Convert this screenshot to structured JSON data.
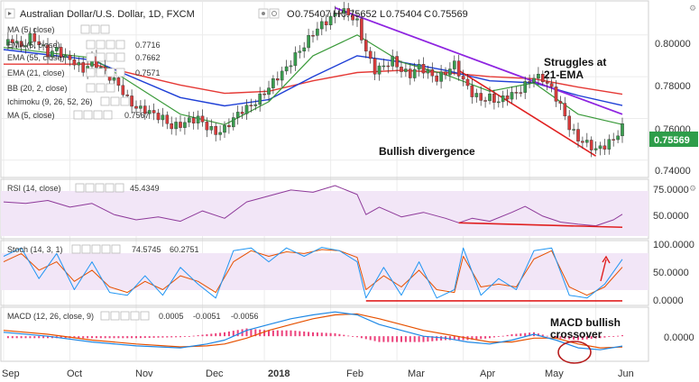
{
  "header": {
    "symbol": "Australian Dollar/U.S. Dollar, 1D, FXCM",
    "o_label": "O",
    "o": "0.75407",
    "h_label": "H",
    "h": "0.75652",
    "l_label": "L",
    "l": "0.75404",
    "c_label": "C",
    "c": "0.75569"
  },
  "indicators": [
    {
      "label": "MA (5, close)",
      "value": "",
      "color": "#222222"
    },
    {
      "label": "EMA (5, close)",
      "value": "0.7716",
      "color": "#e53935"
    },
    {
      "label": "EMA (55, close)",
      "value": "0.7662",
      "color": "#1e3fd6"
    },
    {
      "label": "EMA (21, close)",
      "value": "0.7571",
      "color": "#3a9a3a"
    },
    {
      "label": "BB (20, 2, close)",
      "value": "",
      "color": "#222222"
    },
    {
      "label": "Ichimoku (9, 26, 52, 26)",
      "value": "",
      "color": "#222222"
    },
    {
      "label": "MA (5, close)",
      "value": "0.7567",
      "color": "#1e3fd6"
    }
  ],
  "price_axis": {
    "ticks": [
      "0.80000",
      "0.78000",
      "0.76000",
      "0.74000"
    ],
    "current": "0.75569",
    "current_color": "#2e9d4a"
  },
  "time_axis": {
    "labels": [
      "Sep",
      "Oct",
      "Nov",
      "Dec",
      "2018",
      "Feb",
      "Mar",
      "Apr",
      "May",
      "Jun"
    ]
  },
  "rsi": {
    "label": "RSI (14, close)",
    "value": "45.4349",
    "value_color": "#8e3a9a",
    "ticks": [
      "75.0000",
      "50.0000"
    ]
  },
  "stoch": {
    "label": "Stoch (14, 3, 1)",
    "k": "74.5745",
    "k_color": "#2196f3",
    "d": "60.2751",
    "d_color": "#e65100",
    "ticks": [
      "100.0000",
      "50.0000",
      "0.0000"
    ]
  },
  "macd": {
    "label": "MACD (12, 26, close, 9)",
    "hist": "0.0005",
    "hist_color": "#e91e63",
    "macd": "-0.0051",
    "macd_color": "#1e88e5",
    "signal": "-0.0056",
    "signal_color": "#e65100",
    "ticks": [
      "0.0000"
    ]
  },
  "annotations": {
    "struggles_line1": "Struggles at",
    "struggles_line2": "21-EMA",
    "divergence": "Bullish divergence",
    "macd_line1": "MACD bullish",
    "macd_line2": "crossover"
  },
  "colors": {
    "candle_up": "#3a9d4f",
    "candle_down": "#d83b3b",
    "trendline": "#8e24e0",
    "support": "#e02020"
  },
  "chart_data": [
    {
      "type": "candlestick",
      "title": "Australian Dollar/U.S. Dollar, 1D, FXCM",
      "ylim": [
        0.733,
        0.815
      ],
      "x": [
        "Sep",
        "Oct",
        "Nov",
        "Dec",
        "2018",
        "Feb",
        "Mar",
        "Apr",
        "May",
        "Jun"
      ],
      "close_path": [
        [
          0,
          0.795
        ],
        [
          2,
          0.798
        ],
        [
          4,
          0.794
        ],
        [
          6,
          0.799
        ],
        [
          8,
          0.796
        ],
        [
          10,
          0.791
        ],
        [
          12,
          0.793
        ],
        [
          14,
          0.789
        ],
        [
          16,
          0.787
        ],
        [
          18,
          0.783
        ],
        [
          20,
          0.788
        ],
        [
          22,
          0.784
        ],
        [
          24,
          0.78
        ],
        [
          26,
          0.776
        ],
        [
          28,
          0.769
        ],
        [
          30,
          0.765
        ],
        [
          32,
          0.764
        ],
        [
          34,
          0.762
        ],
        [
          36,
          0.76
        ],
        [
          38,
          0.756
        ],
        [
          40,
          0.757
        ],
        [
          42,
          0.759
        ],
        [
          44,
          0.76
        ],
        [
          46,
          0.756
        ],
        [
          48,
          0.753
        ],
        [
          50,
          0.755
        ],
        [
          52,
          0.76
        ],
        [
          54,
          0.764
        ],
        [
          56,
          0.766
        ],
        [
          58,
          0.77
        ],
        [
          60,
          0.775
        ],
        [
          62,
          0.78
        ],
        [
          64,
          0.784
        ],
        [
          66,
          0.79
        ],
        [
          68,
          0.795
        ],
        [
          70,
          0.801
        ],
        [
          72,
          0.805
        ],
        [
          74,
          0.808
        ],
        [
          76,
          0.812
        ],
        [
          78,
          0.81
        ],
        [
          80,
          0.806
        ],
        [
          82,
          0.792
        ],
        [
          84,
          0.783
        ],
        [
          86,
          0.785
        ],
        [
          88,
          0.788
        ],
        [
          90,
          0.783
        ],
        [
          92,
          0.781
        ],
        [
          94,
          0.785
        ],
        [
          96,
          0.782
        ],
        [
          98,
          0.779
        ],
        [
          100,
          0.782
        ],
        [
          102,
          0.786
        ],
        [
          104,
          0.778
        ],
        [
          106,
          0.772
        ],
        [
          108,
          0.769
        ],
        [
          110,
          0.77
        ],
        [
          112,
          0.768
        ],
        [
          114,
          0.771
        ],
        [
          116,
          0.772
        ],
        [
          118,
          0.776
        ],
        [
          120,
          0.78
        ],
        [
          122,
          0.779
        ],
        [
          124,
          0.774
        ],
        [
          126,
          0.766
        ],
        [
          128,
          0.756
        ],
        [
          130,
          0.75
        ],
        [
          132,
          0.748
        ],
        [
          134,
          0.745
        ],
        [
          136,
          0.747
        ],
        [
          138,
          0.75
        ],
        [
          140,
          0.7557
        ]
      ],
      "ema21_path": [
        [
          0,
          0.794
        ],
        [
          20,
          0.789
        ],
        [
          40,
          0.762
        ],
        [
          50,
          0.757
        ],
        [
          60,
          0.768
        ],
        [
          70,
          0.79
        ],
        [
          80,
          0.8
        ],
        [
          90,
          0.787
        ],
        [
          100,
          0.781
        ],
        [
          110,
          0.773
        ],
        [
          120,
          0.777
        ],
        [
          130,
          0.762
        ],
        [
          140,
          0.7571
        ]
      ],
      "ema55_path": [
        [
          0,
          0.793
        ],
        [
          20,
          0.788
        ],
        [
          40,
          0.77
        ],
        [
          50,
          0.766
        ],
        [
          60,
          0.769
        ],
        [
          70,
          0.78
        ],
        [
          80,
          0.79
        ],
        [
          90,
          0.787
        ],
        [
          100,
          0.783
        ],
        [
          110,
          0.778
        ],
        [
          120,
          0.777
        ],
        [
          130,
          0.771
        ],
        [
          140,
          0.7662
        ]
      ],
      "ema100_path": [
        [
          0,
          0.786
        ],
        [
          20,
          0.786
        ],
        [
          40,
          0.776
        ],
        [
          50,
          0.772
        ],
        [
          60,
          0.773
        ],
        [
          70,
          0.778
        ],
        [
          80,
          0.782
        ],
        [
          90,
          0.783
        ],
        [
          100,
          0.782
        ],
        [
          110,
          0.78
        ],
        [
          120,
          0.779
        ],
        [
          130,
          0.775
        ],
        [
          140,
          0.7716
        ]
      ],
      "resistance_line": [
        [
          75,
          0.813
        ],
        [
          140,
          0.762
        ]
      ],
      "support_line": [
        [
          103,
          0.783
        ],
        [
          134,
          0.742
        ]
      ]
    },
    {
      "type": "line",
      "title": "RSI (14, close)",
      "ylim": [
        15,
        90
      ],
      "rsi_path": [
        [
          0,
          62
        ],
        [
          5,
          60
        ],
        [
          10,
          64
        ],
        [
          15,
          55
        ],
        [
          20,
          60
        ],
        [
          25,
          45
        ],
        [
          30,
          38
        ],
        [
          35,
          42
        ],
        [
          40,
          36
        ],
        [
          45,
          50
        ],
        [
          50,
          40
        ],
        [
          55,
          62
        ],
        [
          60,
          70
        ],
        [
          65,
          78
        ],
        [
          70,
          75
        ],
        [
          75,
          84
        ],
        [
          80,
          72
        ],
        [
          82,
          45
        ],
        [
          85,
          55
        ],
        [
          90,
          42
        ],
        [
          95,
          48
        ],
        [
          100,
          40
        ],
        [
          103,
          34
        ],
        [
          106,
          40
        ],
        [
          110,
          36
        ],
        [
          115,
          48
        ],
        [
          118,
          56
        ],
        [
          122,
          43
        ],
        [
          126,
          35
        ],
        [
          130,
          32
        ],
        [
          134,
          30
        ],
        [
          138,
          38
        ],
        [
          140,
          45.43
        ]
      ],
      "divergence_line": [
        [
          103,
          34
        ],
        [
          140,
          28
        ]
      ]
    },
    {
      "type": "line",
      "title": "Stoch (14, 3, 1)",
      "ylim": [
        -5,
        105
      ],
      "k_path": [
        [
          0,
          80
        ],
        [
          4,
          95
        ],
        [
          8,
          40
        ],
        [
          12,
          85
        ],
        [
          16,
          20
        ],
        [
          20,
          70
        ],
        [
          24,
          15
        ],
        [
          28,
          10
        ],
        [
          32,
          45
        ],
        [
          36,
          10
        ],
        [
          40,
          60
        ],
        [
          44,
          30
        ],
        [
          48,
          5
        ],
        [
          52,
          90
        ],
        [
          56,
          95
        ],
        [
          60,
          70
        ],
        [
          64,
          95
        ],
        [
          68,
          80
        ],
        [
          72,
          96
        ],
        [
          76,
          90
        ],
        [
          80,
          70
        ],
        [
          82,
          5
        ],
        [
          86,
          60
        ],
        [
          90,
          10
        ],
        [
          94,
          70
        ],
        [
          98,
          5
        ],
        [
          102,
          20
        ],
        [
          104,
          95
        ],
        [
          108,
          10
        ],
        [
          112,
          40
        ],
        [
          116,
          20
        ],
        [
          120,
          90
        ],
        [
          124,
          95
        ],
        [
          128,
          10
        ],
        [
          132,
          5
        ],
        [
          136,
          30
        ],
        [
          140,
          74.57
        ]
      ],
      "d_path": [
        [
          0,
          70
        ],
        [
          4,
          85
        ],
        [
          8,
          55
        ],
        [
          12,
          70
        ],
        [
          16,
          35
        ],
        [
          20,
          55
        ],
        [
          24,
          25
        ],
        [
          28,
          15
        ],
        [
          32,
          35
        ],
        [
          36,
          20
        ],
        [
          40,
          45
        ],
        [
          44,
          35
        ],
        [
          48,
          15
        ],
        [
          52,
          70
        ],
        [
          56,
          90
        ],
        [
          60,
          80
        ],
        [
          64,
          88
        ],
        [
          68,
          85
        ],
        [
          72,
          92
        ],
        [
          76,
          90
        ],
        [
          80,
          78
        ],
        [
          82,
          20
        ],
        [
          86,
          45
        ],
        [
          90,
          25
        ],
        [
          94,
          55
        ],
        [
          98,
          20
        ],
        [
          102,
          15
        ],
        [
          104,
          80
        ],
        [
          108,
          25
        ],
        [
          112,
          30
        ],
        [
          116,
          25
        ],
        [
          120,
          75
        ],
        [
          124,
          90
        ],
        [
          128,
          25
        ],
        [
          132,
          10
        ],
        [
          136,
          25
        ],
        [
          140,
          60.28
        ]
      ],
      "support_line": [
        [
          82,
          0
        ],
        [
          140,
          0
        ]
      ]
    },
    {
      "type": "macd",
      "title": "MACD (12, 26, close, 9)",
      "ylim": [
        -0.012,
        0.014
      ],
      "macd_path": [
        [
          0,
          0.002
        ],
        [
          10,
          0.0
        ],
        [
          20,
          -0.003
        ],
        [
          30,
          -0.005
        ],
        [
          40,
          -0.006
        ],
        [
          46,
          -0.004
        ],
        [
          50,
          -0.002
        ],
        [
          55,
          0.003
        ],
        [
          60,
          0.006
        ],
        [
          65,
          0.009
        ],
        [
          70,
          0.011
        ],
        [
          75,
          0.0125
        ],
        [
          80,
          0.011
        ],
        [
          85,
          0.006
        ],
        [
          90,
          0.003
        ],
        [
          95,
          0.0
        ],
        [
          100,
          -0.001
        ],
        [
          105,
          -0.003
        ],
        [
          110,
          -0.004
        ],
        [
          115,
          -0.002
        ],
        [
          120,
          0.001
        ],
        [
          125,
          -0.002
        ],
        [
          130,
          -0.006
        ],
        [
          135,
          -0.007
        ],
        [
          140,
          -0.0051
        ]
      ],
      "signal_path": [
        [
          0,
          0.003
        ],
        [
          10,
          0.001
        ],
        [
          20,
          -0.002
        ],
        [
          30,
          -0.004
        ],
        [
          40,
          -0.0055
        ],
        [
          46,
          -0.005
        ],
        [
          50,
          -0.004
        ],
        [
          55,
          -0.001
        ],
        [
          60,
          0.003
        ],
        [
          65,
          0.006
        ],
        [
          70,
          0.009
        ],
        [
          75,
          0.011
        ],
        [
          80,
          0.0115
        ],
        [
          85,
          0.009
        ],
        [
          90,
          0.006
        ],
        [
          95,
          0.003
        ],
        [
          100,
          0.001
        ],
        [
          105,
          -0.001
        ],
        [
          110,
          -0.003
        ],
        [
          115,
          -0.003
        ],
        [
          120,
          -0.001
        ],
        [
          125,
          -0.001
        ],
        [
          130,
          -0.004
        ],
        [
          135,
          -0.006
        ],
        [
          140,
          -0.0056
        ]
      ]
    }
  ]
}
